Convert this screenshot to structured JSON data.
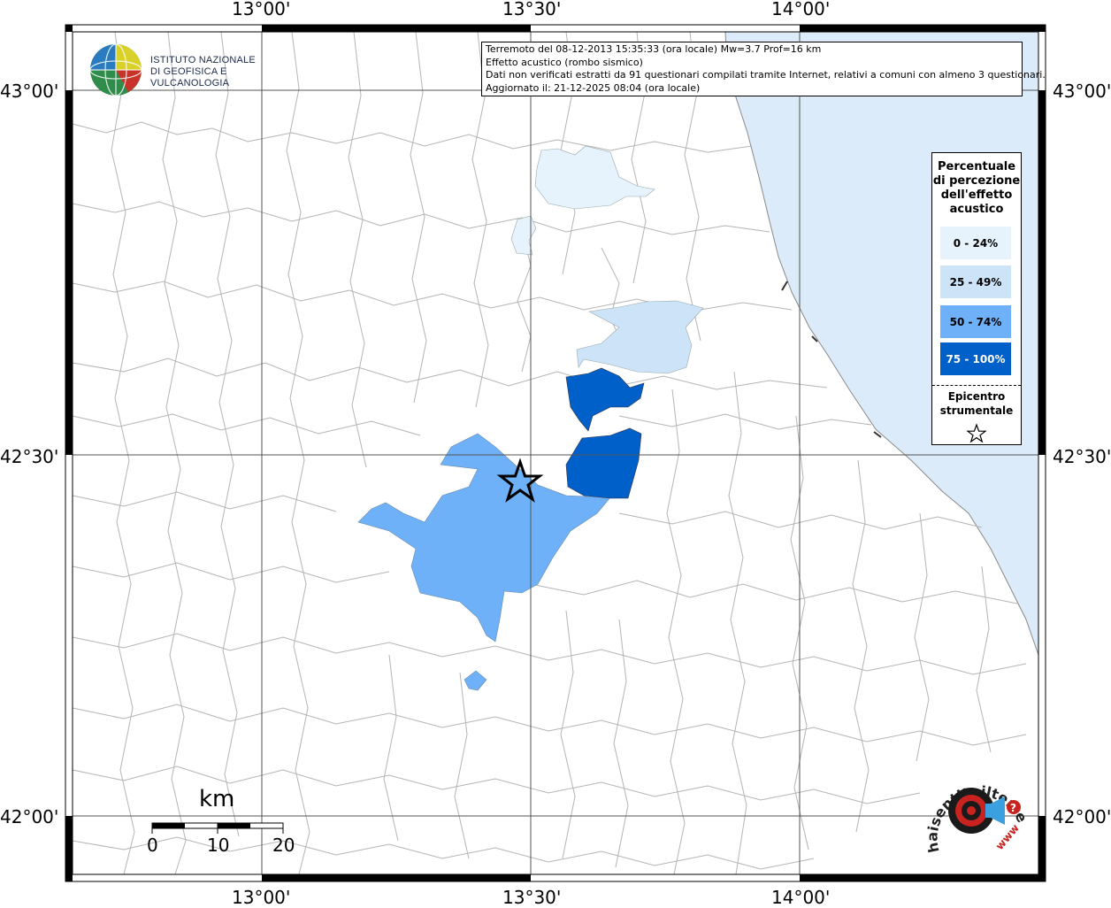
{
  "map": {
    "lon_ticks": [
      "13°00'",
      "13°30'",
      "14°00'"
    ],
    "lat_ticks": [
      "43°00'",
      "42°30'",
      "42°00'"
    ]
  },
  "info": {
    "line1": "Terremoto del 08-12-2013 15:35:33 (ora locale) Mw=3.7 Prof=16 km",
    "line2": "Effetto acustico (rombo sismico)",
    "line3": "Dati non verificati estratti da 91 questionari compilati tramite Internet, relativi a comuni con almeno 3 questionari.",
    "line4": "Aggiornato il: 21-12-2025 08:04 (ora locale)"
  },
  "logo": {
    "line1": "ISTITUTO NAZIONALE",
    "line2": "DI GEOFISICA E VULCANOLOGIA"
  },
  "legend": {
    "title": "Percentuale di percezione dell'effetto acustico",
    "items": [
      {
        "label": "0 - 24%",
        "color": "#e6f2fc"
      },
      {
        "label": "25 - 49%",
        "color": "#cde3f8"
      },
      {
        "label": "50 - 74%",
        "color": "#6eb1f8"
      },
      {
        "label": "75 - 100%",
        "color": "#0060c9"
      }
    ],
    "epicenter_label": "Epicentro strumentale"
  },
  "scale": {
    "unit": "km",
    "labels": [
      "0",
      "10",
      "20"
    ]
  },
  "watermark": {
    "text": "haisentitoilterremoto.it",
    "url": "www"
  },
  "colors": {
    "sea": "#dcebf9",
    "border_lines": "#b4b4b4",
    "grid": "#555555"
  }
}
